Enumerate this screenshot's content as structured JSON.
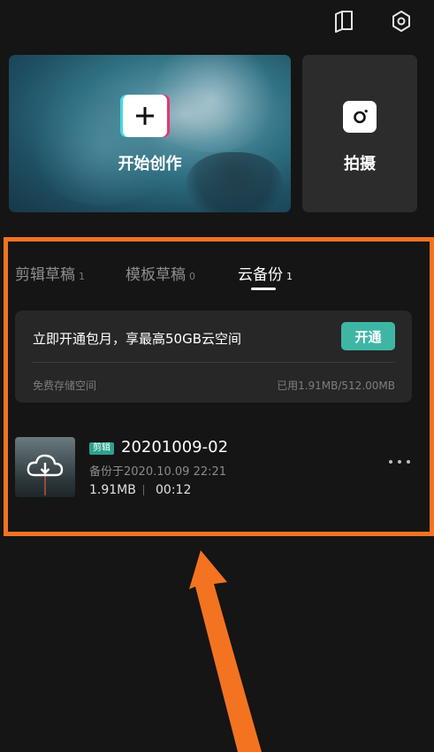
{
  "top_icons": [
    "book-icon",
    "settings-hexagon-icon"
  ],
  "create_card": {
    "label": "开始创作",
    "icon": "plus-icon"
  },
  "shoot_card": {
    "label": "拍摄",
    "icon": "camera-icon"
  },
  "tabs": [
    {
      "label": "剪辑草稿",
      "count": "1",
      "active": false
    },
    {
      "label": "模板草稿",
      "count": "0",
      "active": false
    },
    {
      "label": "云备份",
      "count": "1",
      "active": true
    }
  ],
  "promo": {
    "text": "立即开通包月，享最高50GB云空间",
    "button": "开通",
    "free_storage_label": "免费存储空间",
    "usage": "已用1.91MB/512.00MB"
  },
  "backup_item": {
    "badge": "剪辑",
    "title": "20201009-02",
    "backup_time": "备份于2020.10.09 22:21",
    "size": "1.91MB",
    "duration": "00:12",
    "thumb_icon": "cloud-download-icon",
    "more_icon": "more-dots-icon"
  },
  "colors": {
    "background": "#151515",
    "highlight_frame": "#f47321",
    "accent_button": "#3fb6a5",
    "badge": "#2aa48e"
  }
}
